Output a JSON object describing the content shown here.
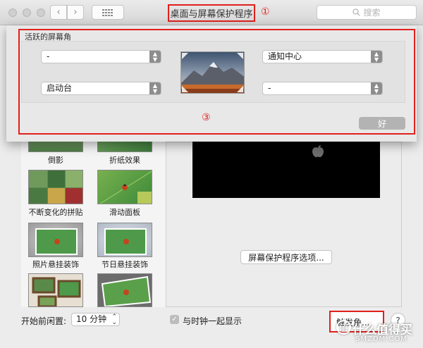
{
  "window": {
    "title": "桌面与屏幕保护程序",
    "search_placeholder": "搜索",
    "callout_1": "①",
    "callout_3": "③"
  },
  "sheet": {
    "title": "活跃的屏幕角",
    "top_left": "-",
    "bottom_left": "启动台",
    "top_right": "通知中心",
    "bottom_right": "-",
    "ok_label": "好"
  },
  "screensavers": [
    {
      "label": "倒影"
    },
    {
      "label": "折纸效果"
    },
    {
      "label": "不断变化的拼贴"
    },
    {
      "label": "滑动面板"
    },
    {
      "label": "照片悬挂装饰"
    },
    {
      "label": "节日悬挂装饰"
    }
  ],
  "main": {
    "options_button": "屏幕保护程序选项..."
  },
  "bottom": {
    "idle_label": "开始前闲置:",
    "idle_value": "10 分钟",
    "clock_label": "与时钟一起显示",
    "hot_corners_label": "触发角...",
    "help": "?"
  },
  "watermark": {
    "badge": "值",
    "line1": "什么值得买",
    "line2": "SMZDM.COM"
  },
  "colors": {
    "callout_red": "#e0201c",
    "ok_disabled": "#b3b3b3"
  }
}
